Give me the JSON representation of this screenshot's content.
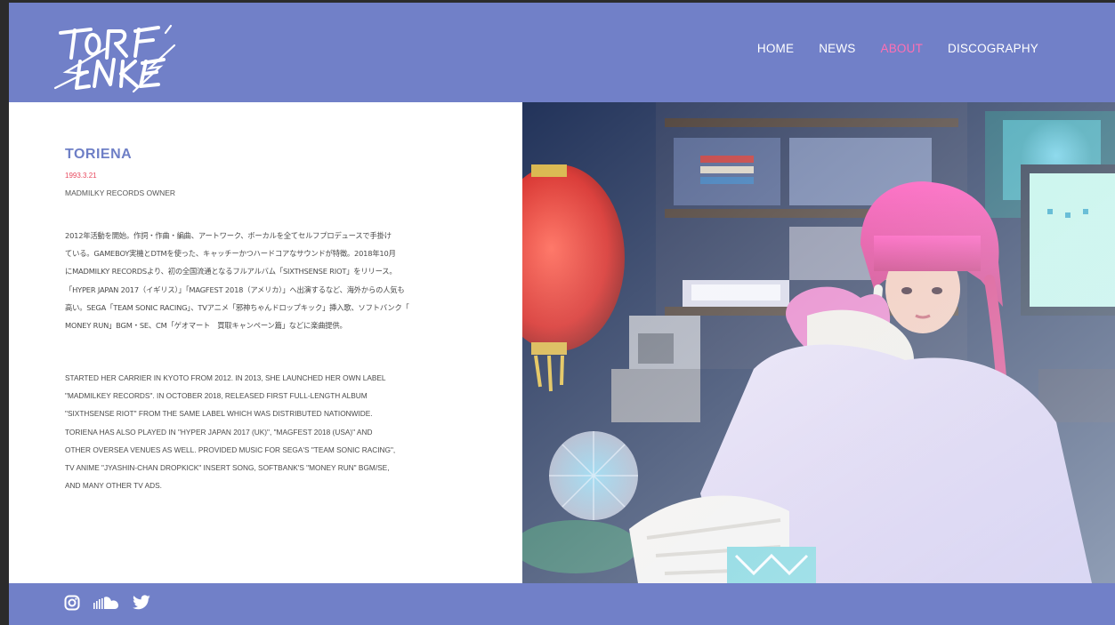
{
  "header": {
    "logo_text": "TORIENA",
    "nav": [
      {
        "label": "HOME",
        "active": false
      },
      {
        "label": "NEWS",
        "active": false
      },
      {
        "label": "ABOUT",
        "active": true
      },
      {
        "label": "DISCOGRAPHY",
        "active": false
      }
    ]
  },
  "profile": {
    "name": "TORIENA",
    "birthdate": "1993.3.21",
    "role": "MADMILKY RECORDS OWNER",
    "bio_jp": [
      " 2012年活動を開始。作詞・作曲・編曲、アートワーク、ボーカルを全てセルフプロデュースで手掛け",
      "ている。GAMEBOY実機とDTMを使った、キャッチーかつハードコアなサウンドが特徴。2018年10月",
      "にMADMILKY RECORDSより、初の全国流通となるフルアルバム「SIXTHSENSE RIOT」をリリース。",
      "「HYPER JAPAN 2017（イギリス）」「MAGFEST 2018（アメリカ）」へ出演するなど、海外からの人気も",
      "高い。SEGA「TEAM SONIC RACING」、TVアニメ「邪神ちゃんドロップキック」挿入歌、ソフトバンク「",
      "MONEY RUN」BGM・SE、CM「ゲオマート　買取キャンペーン篇」などに楽曲提供。"
    ],
    "bio_en": [
      "STARTED HER CARRIER IN KYOTO FROM 2012. IN 2013, SHE LAUNCHED HER OWN LABEL",
      "\"MADMILKEY RECORDS\". IN OCTOBER 2018, RELEASED FIRST FULL-LENGTH ALBUM",
      "\"SIXTHSENSE RIOT\" FROM THE SAME LABEL WHICH WAS DISTRIBUTED NATIONWIDE.",
      "TORIENA HAS ALSO PLAYED IN \"HYPER JAPAN 2017 (UK)\", \"MAGFEST 2018 (USA)\" AND",
      "OTHER OVERSEA VENUES AS WELL. PROVIDED MUSIC FOR SEGA'S \"TEAM SONIC RACING\",",
      "TV ANIME \"JYASHIN-CHAN DROPKICK\" INSERT SONG, SOFTBANK'S \"MONEY RUN\" BGM/SE,",
      "AND MANY OTHER TV ADS."
    ]
  },
  "footer": {
    "social_icons": [
      "instagram-icon",
      "soundcloud-icon",
      "twitter-icon"
    ]
  },
  "colors": {
    "brand": "#7180c8",
    "accent": "#ff6fb3",
    "name": "#6e7fc6",
    "date": "#e84a5f"
  }
}
